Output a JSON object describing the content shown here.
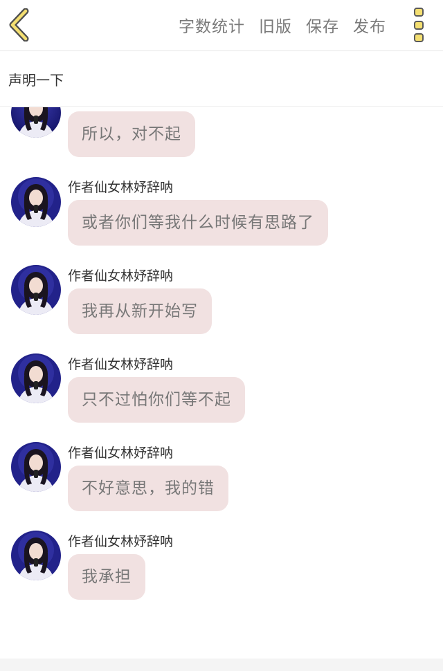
{
  "toolbar": {
    "back_icon": "chevron-left-icon",
    "actions": [
      {
        "label": "字数统计"
      },
      {
        "label": "旧版"
      },
      {
        "label": "保存"
      },
      {
        "label": "发布"
      }
    ],
    "more_icon": "more-vertical-icon",
    "accent": "#f4df71"
  },
  "editor": {
    "title_value": "声明一下_"
  },
  "messages": [
    {
      "sender": "",
      "text": "所以，对不起"
    },
    {
      "sender": "作者仙女林妤辞呐",
      "text": "或者你们等我什么时候有思路了"
    },
    {
      "sender": "作者仙女林妤辞呐",
      "text": "我再从新开始写"
    },
    {
      "sender": "作者仙女林妤辞呐",
      "text": "只不过怕你们等不起"
    },
    {
      "sender": "作者仙女林妤辞呐",
      "text": "不好意思，我的错"
    },
    {
      "sender": "作者仙女林妤辞呐",
      "text": "我承担"
    }
  ],
  "colors": {
    "bubble": "#f1e1e1",
    "bubble_text": "#777777",
    "action_text": "#7a7a7a"
  }
}
